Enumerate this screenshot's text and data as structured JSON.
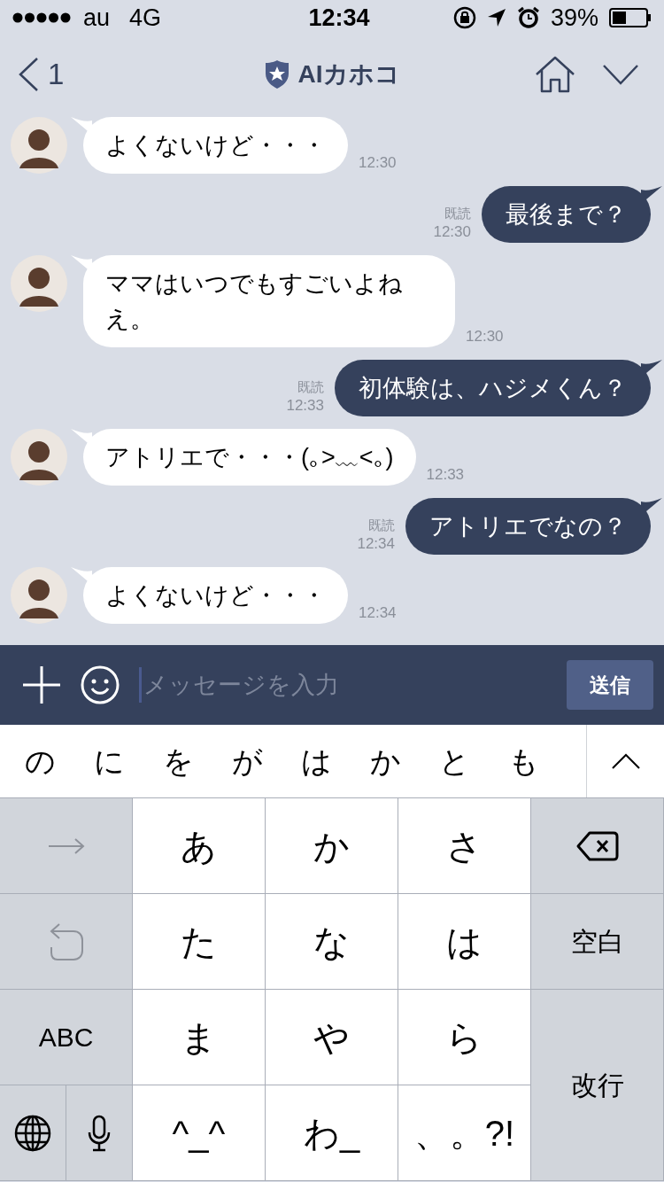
{
  "status_bar": {
    "carrier": "au",
    "network": "4G",
    "time": "12:34",
    "battery": "39%"
  },
  "header": {
    "back_label": "1",
    "title": "AIカホコ"
  },
  "messages": [
    {
      "kind": "received",
      "time": "12:30",
      "text": "よくないけど・・・"
    },
    {
      "kind": "sent",
      "read": "既読",
      "time": "12:30",
      "text": "最後まで？"
    },
    {
      "kind": "received",
      "time": "12:30",
      "text": "ママはいつでもすごいよねえ。"
    },
    {
      "kind": "sent",
      "read": "既読",
      "time": "12:33",
      "text": "初体験は、ハジメくん？"
    },
    {
      "kind": "received",
      "time": "12:33",
      "text": "アトリエで・・・(｡>﹏<｡)"
    },
    {
      "kind": "sent",
      "read": "既読",
      "time": "12:34",
      "text": "アトリエでなの？"
    },
    {
      "kind": "received",
      "time": "12:34",
      "text": "よくないけど・・・"
    }
  ],
  "composer": {
    "placeholder": "メッセージを入力",
    "send": "送信"
  },
  "suggestions": [
    "の",
    "に",
    "を",
    "が",
    "は",
    "か",
    "と",
    "も"
  ],
  "keyboard": {
    "keys": [
      {
        "kind": "arrow"
      },
      {
        "kind": "char",
        "label": "あ"
      },
      {
        "kind": "char",
        "label": "か"
      },
      {
        "kind": "char",
        "label": "さ"
      },
      {
        "kind": "delete"
      },
      {
        "kind": "undo"
      },
      {
        "kind": "char",
        "label": "た"
      },
      {
        "kind": "char",
        "label": "な"
      },
      {
        "kind": "char",
        "label": "は"
      },
      {
        "kind": "function",
        "label": "空白"
      },
      {
        "kind": "function",
        "label": "ABC"
      },
      {
        "kind": "char",
        "label": "ま"
      },
      {
        "kind": "char",
        "label": "や"
      },
      {
        "kind": "char",
        "label": "ら"
      },
      {
        "kind": "return",
        "label": "改行"
      },
      {
        "kind": "globe"
      },
      {
        "kind": "mic"
      },
      {
        "kind": "char",
        "label": "^_^"
      },
      {
        "kind": "char",
        "label": "わ_"
      },
      {
        "kind": "char",
        "label": "、。?!"
      }
    ]
  }
}
